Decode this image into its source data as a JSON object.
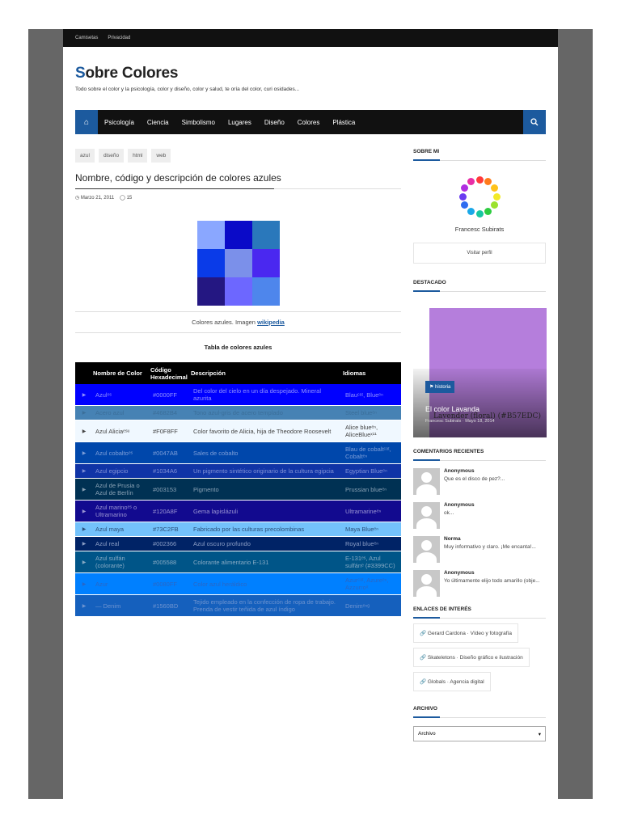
{
  "topbar": [
    "Camisetas",
    "Privacidad"
  ],
  "site": {
    "title_first": "S",
    "title_rest": "obre Colores",
    "tagline": "Todo sobre el color y la psicología, color y diseño, color y salud, te oría del color, curi osidades..."
  },
  "nav": [
    "Psicología",
    "Ciencia",
    "Simbolismo",
    "Lugares",
    "Diseño",
    "Colores",
    "Plástica"
  ],
  "post": {
    "tags": [
      "azul",
      "diseño",
      "html",
      "web"
    ],
    "title": "Nombre, código y descripción de colores azules",
    "date": "Marzo 21, 2011",
    "comments": "15",
    "swatches": [
      "#8aa7ff",
      "#0a0ac8",
      "#2a78bb",
      "#0a3be8",
      "#7b90ea",
      "#4a28f0",
      "#241782",
      "#6d67ff",
      "#4e86ec"
    ],
    "caption_text": "Colores azules. Imagen",
    "caption_link": "wikipedia",
    "table_title": "Tabla de colores azules",
    "table_headers": [
      "Nombre de Color",
      "Código Hexadecimal",
      "Descripción",
      "Idiomas"
    ],
    "rows": [
      {
        "name": "Azulᵉˢ",
        "hex": "#0000FF",
        "desc": "Del color del cielo en un día despejado. Mineral azurita",
        "lang": "Blauᶜᵃᵗ, Blueᵉⁿ",
        "bg": "#0000ff",
        "fg": "#9090ff"
      },
      {
        "name": "Acero azul",
        "hex": "#4682B4",
        "desc": "Tono azul-gris de acero templado",
        "lang": "Steel blueᵉⁿ",
        "bg": "#4682b4",
        "fg": "#3b6e99"
      },
      {
        "name": "Azul Aliciaᵉˢᵘ",
        "hex": "#F0F8FF",
        "desc": "Color favorito de Alicia, hija de Theodore Roosevelt",
        "lang": "Alice blueᵉⁿ, AliceBlueˣ¹¹",
        "bg": "#f0f8ff",
        "fg": "#444444"
      },
      {
        "name": "Azul cobaltoᵉˢ",
        "hex": "#0047AB",
        "desc": "Sales de cobalto",
        "lang": "Blau de cobaltᶜᵃᵗ, Cobaltᵉⁿ",
        "bg": "#0047ab",
        "fg": "#7d9ed8"
      },
      {
        "name": "Azul egipcio",
        "hex": "#1034A6",
        "desc": "Un pigmento sintético originario de la cultura egipcia",
        "lang": "Egyptian Blueᵉⁿ",
        "bg": "#1034a6",
        "fg": "#7f8fd6"
      },
      {
        "name": "Azul de Prusia o Azul de Berlín",
        "hex": "#003153",
        "desc": "Pigmento",
        "lang": "Prussian blueᵉⁿ",
        "bg": "#003153",
        "fg": "#8aa2b5"
      },
      {
        "name": "Azul marinoᵉˢ o Ultramarino",
        "hex": "#120A8F",
        "desc": "Gema lapislázuli",
        "lang": "Ultramarineᵉⁿ",
        "bg": "#120a8f",
        "fg": "#9b96d3"
      },
      {
        "name": "Azul maya",
        "hex": "#73C2FB",
        "desc": "Fabricado por las culturas precolombinas",
        "lang": "Maya Blueᵉⁿ",
        "bg": "#73c2fb",
        "fg": "#2a4f7a"
      },
      {
        "name": "Azul real",
        "hex": "#002366",
        "desc": "Azul oscuro profundo",
        "lang": "Royal blueᵉⁿ",
        "bg": "#002366",
        "fg": "#8c9fc6"
      },
      {
        "name": "Azul sulfán (colorante)",
        "hex": "#005588",
        "desc": "Colorante alimentario E-131",
        "lang": "E-131ᵉˢ, Azul sulfánᵉ (#3399CC)",
        "bg": "#005588",
        "fg": "#87aac4"
      },
      {
        "name": "Azur",
        "hex": "#0080FF",
        "desc": "Color azul heráldico",
        "lang": "Azurᶜᵃᵗ, Azureᵉⁿ, Azzurroⁱᵗ",
        "bg": "#0080ff",
        "fg": "#2a66c4"
      },
      {
        "name": "— Denim",
        "hex": "#1560BD",
        "desc": "Tejido empleado en la confección de ropa de trabajo. Prenda de vestir teñida de azul índigo",
        "lang": "Denimᵉⁿᵍ",
        "bg": "#1560bd",
        "fg": "#6d93d0"
      }
    ]
  },
  "sidebar": {
    "about_title": "SOBRE MI",
    "author_name": "Francesc Subirats",
    "visit_label": "Visitar perfil",
    "featured_title": "DESTACADO",
    "featured_badge": "historia",
    "featured_post_title": "El color Lavanda",
    "featured_overlay": "Lavender (floral) (#B57EDC)",
    "featured_meta": "Francesc Subirats · Mayo 18, 2014",
    "recent_title": "COMENTARIOS RECIENTES",
    "comments": [
      {
        "author": "Anonymous",
        "text": "Que es el disco de pez?..."
      },
      {
        "author": "Anonymous",
        "text": "ok..."
      },
      {
        "author": "Norma",
        "text": "Muy informativo y claro. ¡Me encanta!..."
      },
      {
        "author": "Anonymous",
        "text": "Yo últimamente elijo todo amarillo (obje..."
      }
    ],
    "links_title": "ENLACES DE INTERÉS",
    "links": [
      "Gerard Cardona · Vídeo y fotografía",
      "Skateletons · Diseño gráfico e ilustración",
      "Globals · Agencia digital"
    ],
    "archive_title": "ARCHIVO",
    "archive_select": "Archivo"
  }
}
